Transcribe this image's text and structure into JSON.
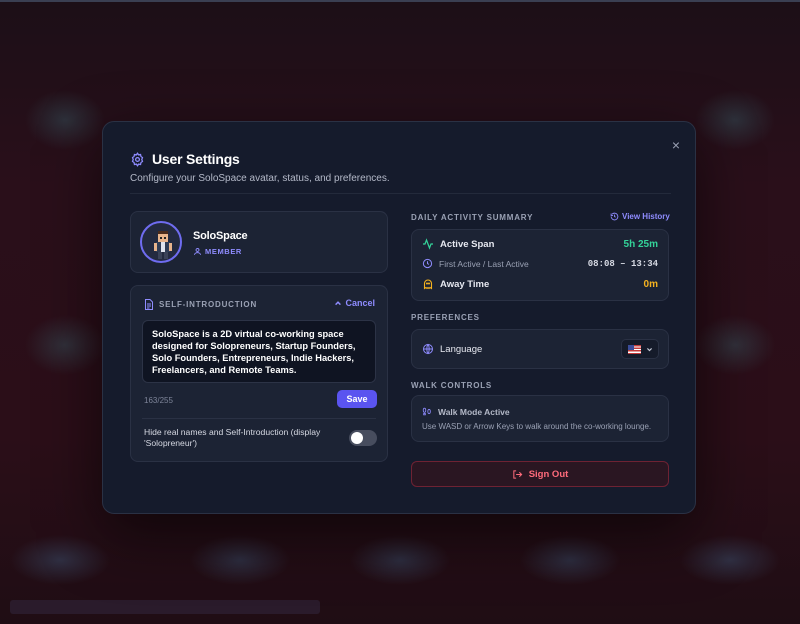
{
  "modal": {
    "title": "User Settings",
    "subtitle": "Configure your SoloSpace avatar, status, and preferences.",
    "close_label": "×"
  },
  "profile": {
    "name": "SoloSpace",
    "role": "MEMBER"
  },
  "self_intro": {
    "label": "SELF-INTRODUCTION",
    "cancel_label": "Cancel",
    "text": "SoloSpace is a 2D virtual co-working space designed for Solopreneurs, Startup Founders, Solo Founders, Entrepreneurs, Indie Hackers, Freelancers, and Remote Teams.",
    "counter": "163/255",
    "save_label": "Save",
    "hide_names_label": "Hide real names and Self-Introduction (display 'Solopreneur')",
    "hide_names_enabled": false
  },
  "activity": {
    "section_title": "DAILY ACTIVITY SUMMARY",
    "view_history_label": "View History",
    "active_span_label": "Active Span",
    "active_span_value": "5h 25m",
    "first_last_label": "First Active / Last Active",
    "first_last_value": "08:08 – 13:34",
    "away_label": "Away Time",
    "away_value": "0m"
  },
  "preferences": {
    "section_title": "PREFERENCES",
    "language_label": "Language",
    "language_flag": "us-flag"
  },
  "walk": {
    "section_title": "WALK CONTROLS",
    "mode_label": "Walk Mode Active",
    "hint": "Use WASD or Arrow Keys to walk around the co-working lounge."
  },
  "signout_label": "Sign Out",
  "colors": {
    "accent": "#6f6cf0",
    "active_green": "#34d399",
    "away_amber": "#f5b21f",
    "danger": "#ff6b7b"
  }
}
